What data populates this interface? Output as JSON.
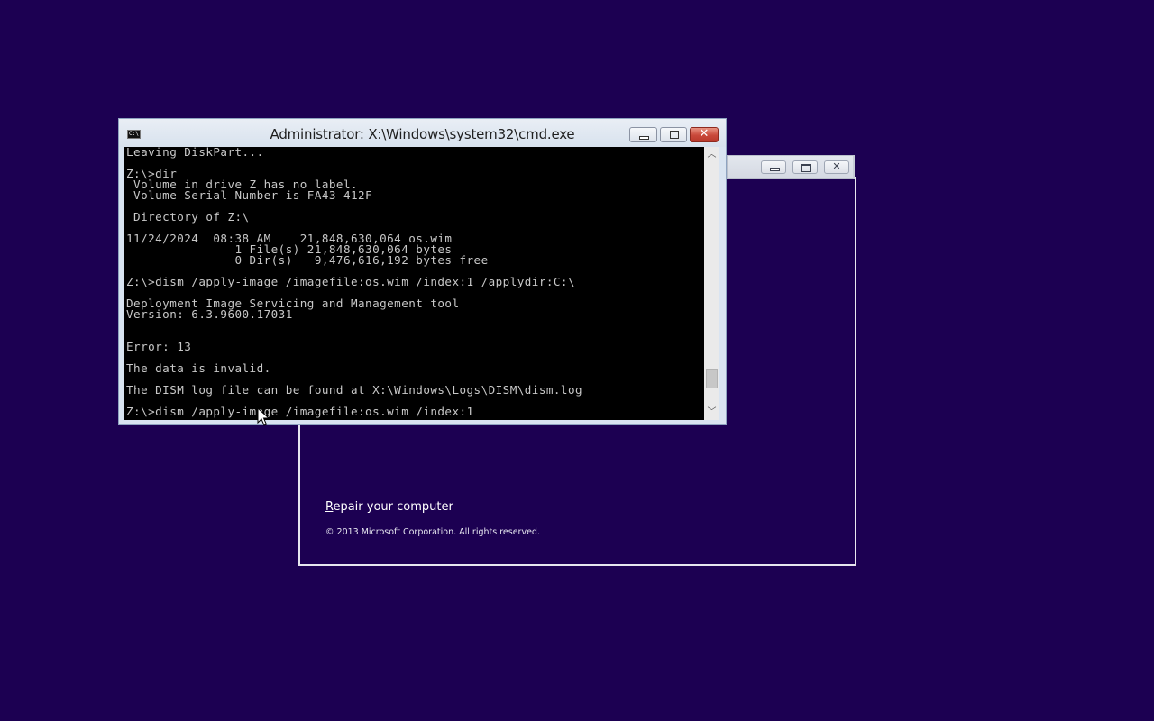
{
  "cmd_window": {
    "title": "Administrator: X:\\Windows\\system32\\cmd.exe",
    "icon_label": "C:\\",
    "console_lines": [
      "Leaving DiskPart...",
      "",
      "Z:\\>dir",
      " Volume in drive Z has no label.",
      " Volume Serial Number is FA43-412F",
      "",
      " Directory of Z:\\",
      "",
      "11/24/2024  08:38 AM    21,848,630,064 os.wim",
      "               1 File(s) 21,848,630,064 bytes",
      "               0 Dir(s)   9,476,616,192 bytes free",
      "",
      "Z:\\>dism /apply-image /imagefile:os.wim /index:1 /applydir:C:\\",
      "",
      "Deployment Image Servicing and Management tool",
      "Version: 6.3.9600.17031",
      "",
      "",
      "Error: 13",
      "",
      "The data is invalid.",
      "",
      "The DISM log file can be found at X:\\Windows\\Logs\\DISM\\dism.log",
      "",
      "Z:\\>dism /apply-image /imagefile:os.wim /index:1"
    ]
  },
  "setup_window": {
    "repair_link_first": "R",
    "repair_link_rest": "epair your computer",
    "copyright": "© 2013 Microsoft Corporation. All rights reserved."
  },
  "icons": {
    "minimize": "minimize-icon",
    "maximize": "maximize-icon",
    "close": "close-icon",
    "scroll_up": "chevron-up-icon",
    "scroll_down": "chevron-down-icon",
    "cursor": "mouse-pointer-icon"
  },
  "colors": {
    "desktop_background": "#1c0052",
    "console_background": "#000000",
    "console_text": "#c8c8c8",
    "close_button": "#c9483a"
  }
}
